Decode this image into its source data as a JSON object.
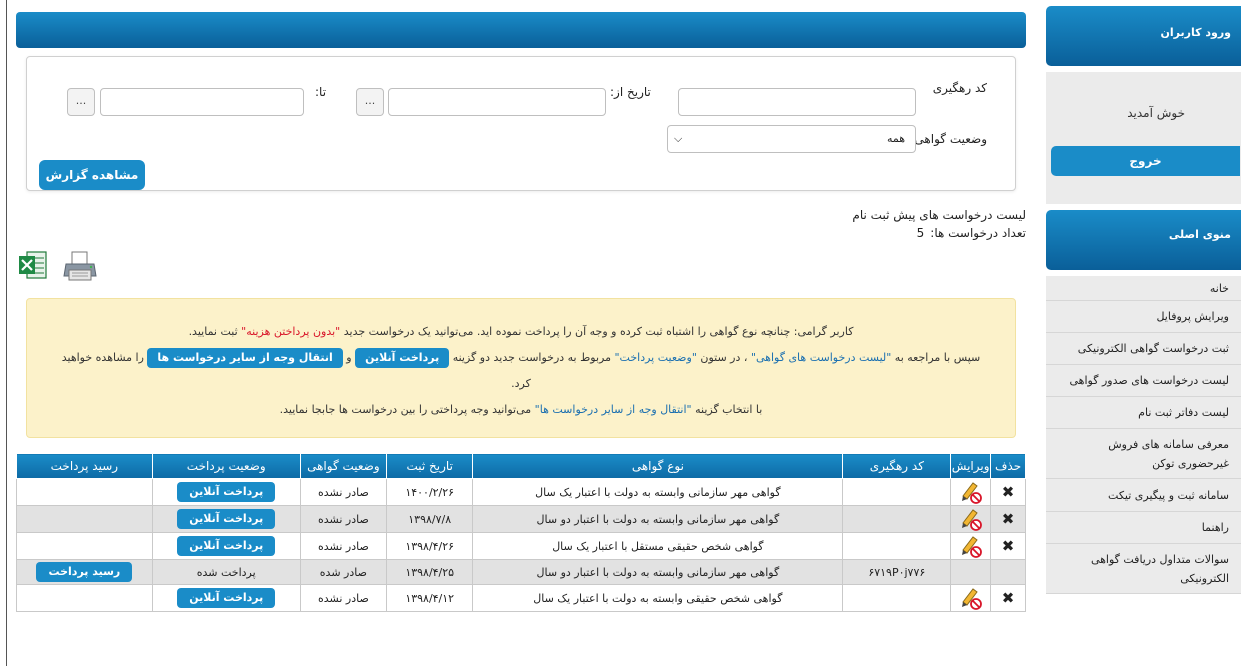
{
  "header": {
    "title": ""
  },
  "filters": {
    "tracking_code_label": "کد رهگیری",
    "tracking_code_value": "",
    "date_from_label": "تاریخ از:",
    "date_from_value": "",
    "date_to_label": "تا:",
    "date_to_value": "",
    "picker_label": "...",
    "status_label": "وضعیت گواهی",
    "status_selected": "همه",
    "report_button": "مشاهده گزارش"
  },
  "list": {
    "title": "لیست درخواست های پیش ثبت نام",
    "count_label": "تعداد درخواست ها:",
    "count_value": "5"
  },
  "toolbar": {
    "excel_icon": "excel-export-icon",
    "print_icon": "printer-icon"
  },
  "notice": {
    "line1_a": "کاربر گرامی: چنانچه نوع گواهی را اشتباه ثبت کرده و وجه آن را پرداخت نموده اید. می‌توانید یک درخواست جدید ",
    "line1_red": "\"بدون پرداختن هزینه\"",
    "line1_b": " ثبت نمایید.",
    "line2_a": "سپس با مراجعه به ",
    "line2_blue1": "\"لیست درخواست های گواهی\"",
    "line2_b": " ، در ستون ",
    "line2_blue2": "\"وضعیت پرداخت\"",
    "line2_c": " مربوط به درخواست جدید دو گزینه ",
    "pill_online": "پرداخت آنلاین",
    "line2_and": " و ",
    "pill_transfer": "انتقال وجه از سایر درخواست ها",
    "line2_d": " را مشاهده خواهید",
    "line3": "کرد.",
    "line4_a": "با انتخاب گزینه ",
    "line4_blue": "\"انتقال وجه از سایر درخواست ها\"",
    "line4_b": " می‌توانید وجه پرداختی را بین درخواست ها جابجا نمایید."
  },
  "table": {
    "headers": [
      "حذف",
      "ویرایش",
      "کد رهگیری",
      "نوع گواهی",
      "تاریخ ثبت",
      "وضعیت گواهی",
      "وضعیت پرداخت",
      "رسید پرداخت"
    ],
    "rows": [
      {
        "delete": "✖",
        "tracking": "",
        "type": "گواهی مهر سازمانی وابسته به دولت با اعتبار یک سال",
        "date": "۱۴۰۰/۲/۲۶",
        "status": "صادر نشده",
        "pay": "پرداخت آنلاین",
        "receipt": ""
      },
      {
        "delete": "✖",
        "tracking": "",
        "type": "گواهی مهر سازمانی وابسته به دولت با اعتبار دو سال",
        "date": "۱۳۹۸/۷/۸",
        "status": "صادر نشده",
        "pay": "پرداخت آنلاین",
        "receipt": ""
      },
      {
        "delete": "✖",
        "tracking": "",
        "type": "گواهی شخص حقیقی مستقل با اعتبار یک سال",
        "date": "۱۳۹۸/۴/۲۶",
        "status": "صادر نشده",
        "pay": "پرداخت آنلاین",
        "receipt": ""
      },
      {
        "delete": "",
        "tracking": "۶۷۱۹P۰j۷۷۶",
        "type": "گواهی مهر سازمانی وابسته به دولت با اعتبار دو سال",
        "date": "۱۳۹۸/۴/۲۵",
        "status": "صادر شده",
        "pay": "پرداخت شده",
        "receipt": "رسید پرداخت"
      },
      {
        "delete": "✖",
        "tracking": "",
        "type": "گواهی شخص حقیقی وابسته به دولت با اعتبار یک سال",
        "date": "۱۳۹۸/۴/۱۲",
        "status": "صادر نشده",
        "pay": "پرداخت آنلاین",
        "receipt": ""
      }
    ]
  },
  "sidebar": {
    "login_title": "ورود کاربران",
    "welcome": "خوش آمدید",
    "logout": "خروج",
    "menu_title": "منوی اصلی",
    "items": [
      "خانه",
      "ویرایش پروفایل",
      "ثبت درخواست گواهی الکترونیکی",
      "لیست درخواست های صدور گواهی",
      "لیست دفاتر ثبت نام",
      "معرفی سامانه های فروش غیرحضوری توکن",
      "سامانه ثبت و پیگیری تیکت",
      "راهنما",
      "سوالات متداول دریافت گواهی الکترونیکی"
    ]
  }
}
